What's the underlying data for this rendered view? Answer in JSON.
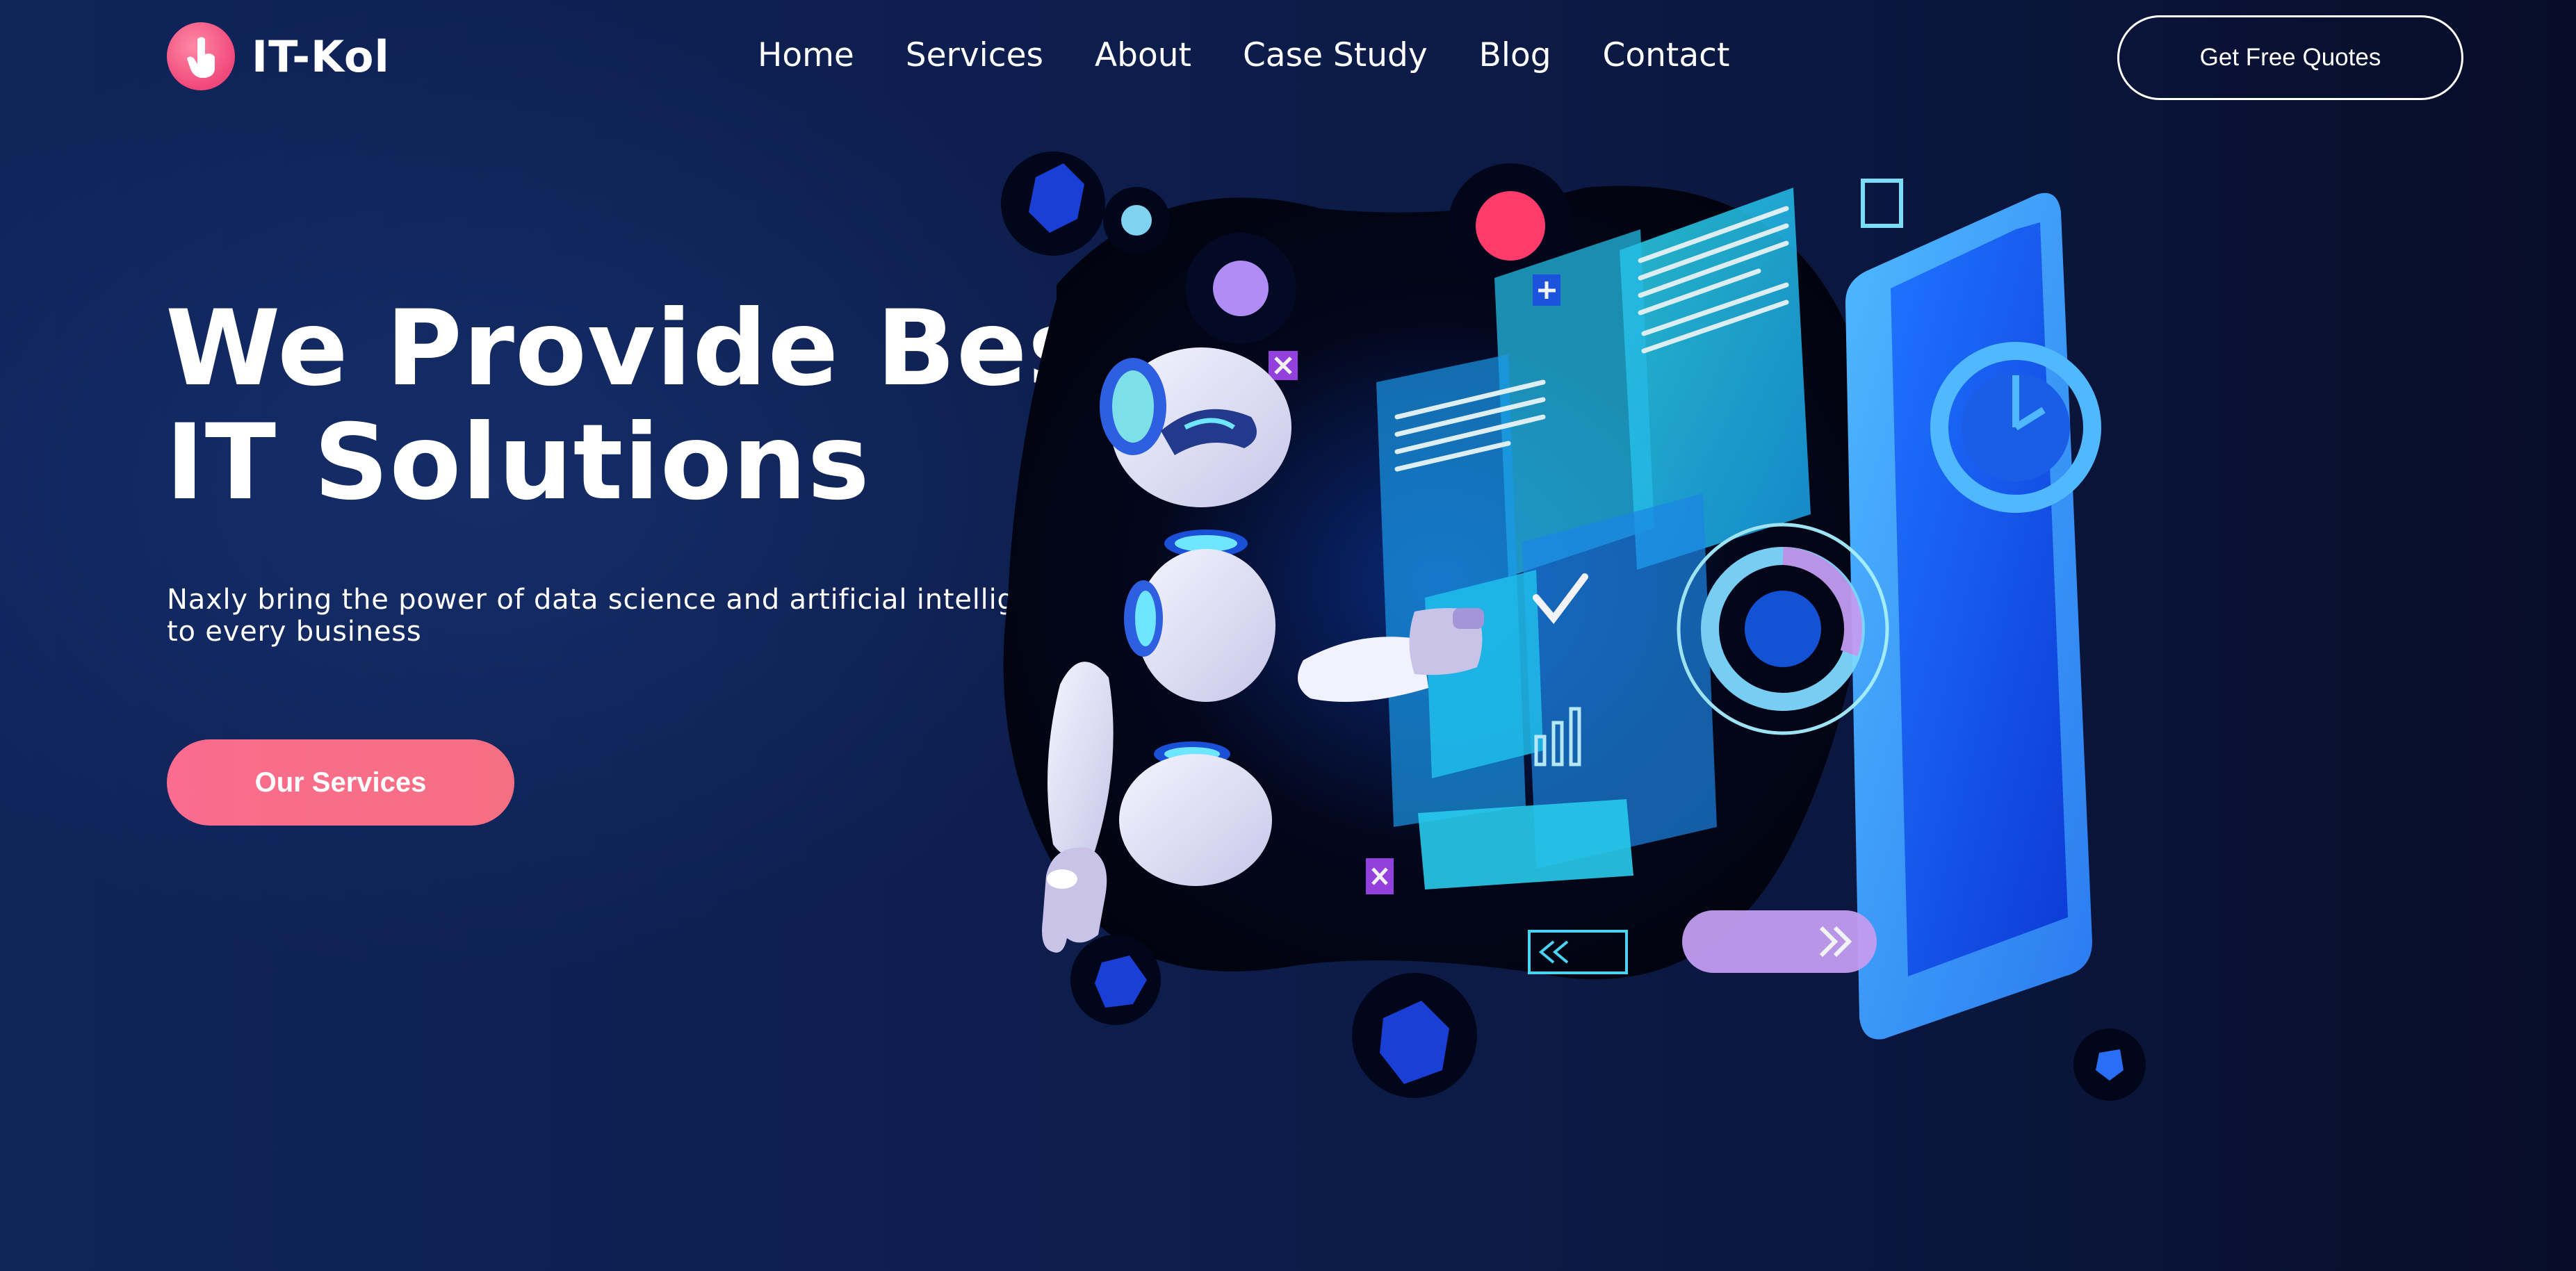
{
  "header": {
    "logo_text": "IT-Kol",
    "nav": [
      "Home",
      "Services",
      "About",
      "Case Study",
      "Blog",
      "Contact"
    ],
    "cta_label": "Get Free Quotes"
  },
  "hero": {
    "title_line1": "We Provide Best",
    "title_line2": "IT Solutions",
    "subtitle": "Naxly bring the power of data science and artificial intelligence to every business",
    "button_label": "Our Services"
  },
  "colors": {
    "background": "#0c1b45",
    "accent": "#f56f82",
    "logo": "#f0487a",
    "illustration_cyan": "#26d6f2",
    "illustration_blue": "#1650e0"
  },
  "icons": {
    "logo": "hand-pointer-icon"
  }
}
